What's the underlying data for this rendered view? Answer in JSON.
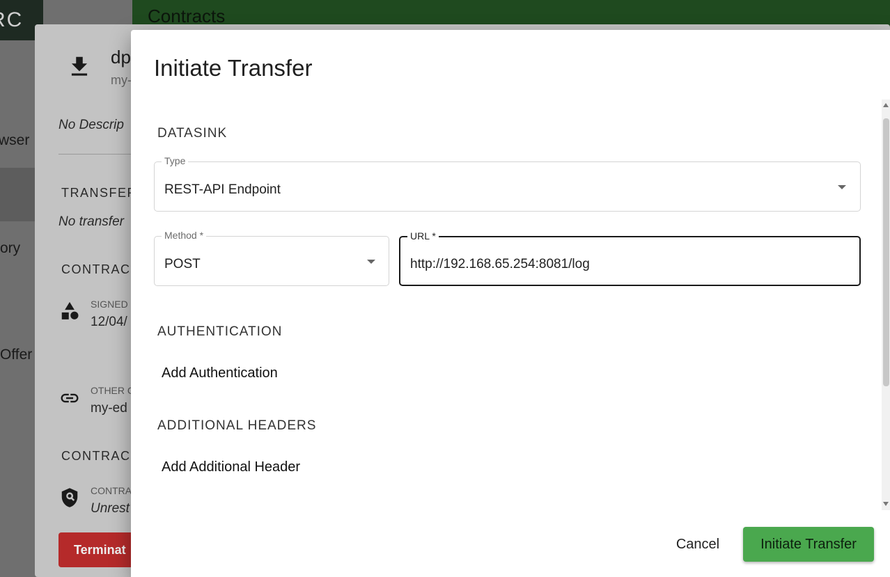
{
  "background": {
    "logo_text": "RC",
    "nav_items": [
      "wser",
      "ory",
      "Offer"
    ],
    "topbar_title": "Contracts",
    "detail": {
      "title": "dp",
      "subtitle": "my-",
      "description": "No Descrip",
      "transfer_section": "TRANSFER",
      "transfer_empty": "No transfer",
      "contract_section_1": "CONTRAC",
      "signed_label": "SIGNED",
      "signed_value": "12/04/",
      "other_label": "OTHER C",
      "other_value": "my-ed",
      "contract_section_2": "CONTRAC",
      "policy_label": "CONTRA",
      "policy_value": "Unrest",
      "terminate_label": "Terminat"
    }
  },
  "dialog": {
    "title": "Initiate Transfer",
    "datasink": {
      "section_label": "DATASINK",
      "type": {
        "label": "Type",
        "value": "REST-API Endpoint"
      },
      "method": {
        "label": "Method *",
        "value": "POST"
      },
      "url": {
        "label": "URL *",
        "value": "http://192.168.65.254:8081/log"
      }
    },
    "authentication": {
      "section_label": "AUTHENTICATION",
      "add_label": "Add Authentication"
    },
    "headers": {
      "section_label": "ADDITIONAL HEADERS",
      "add_label": "Add Additional Header"
    },
    "actions": {
      "cancel_label": "Cancel",
      "confirm_label": "Initiate Transfer"
    }
  },
  "colors": {
    "primary_green": "#4aa84e",
    "danger_red": "#b52a2a",
    "topbar_green": "#1f4a1f"
  }
}
